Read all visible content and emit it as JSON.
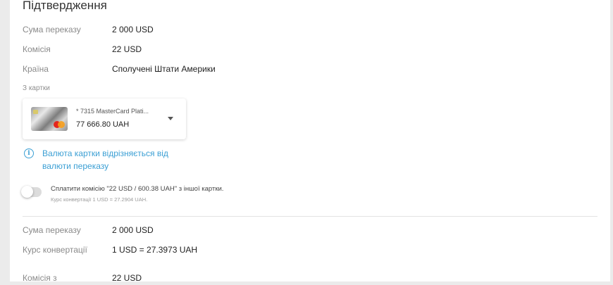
{
  "confirmation": {
    "title": "Підтвердження",
    "rows": [
      {
        "label": "Сума переказу",
        "value": "2 000 USD"
      },
      {
        "label": "Комісія",
        "value": "22 USD"
      },
      {
        "label": "Країна",
        "value": "Сполучені Штати Америки"
      }
    ],
    "from_card_label": "З картки",
    "card": {
      "name": "* 7315  MasterCard Plati...",
      "balance": "77 666.80 UAH"
    },
    "currency_notice": "Валюта картки відрізняється від валюти переказу",
    "commission_toggle": {
      "label": "Сплатити комісію \"22 USD / 600.38 UAH\" з іншої картки.",
      "enabled": false,
      "rate_note": "Курс конвертації 1 USD = 27.2904 UAH."
    },
    "summary_rows": [
      {
        "label": "Сума переказу",
        "value": "2 000 USD"
      },
      {
        "label": "Курс конвертації",
        "value": "1 USD = 27.3973 UAH"
      },
      {
        "label": "Комісія з",
        "value": "22 USD"
      }
    ]
  },
  "colors": {
    "accent_blue": "#3b9fd4",
    "mastercard_red": "#e3261f",
    "mastercard_orange": "#f79e1b"
  },
  "icons": [
    "info-icon",
    "chevron-down-icon",
    "mastercard-logo-icon"
  ]
}
